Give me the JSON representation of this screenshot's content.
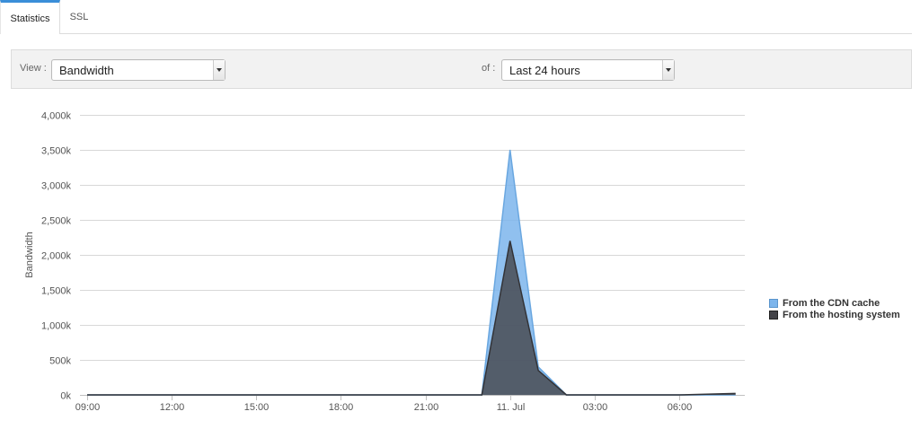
{
  "tabs": [
    {
      "label": "Statistics",
      "active": true
    },
    {
      "label": "SSL",
      "active": false
    }
  ],
  "filters": {
    "view_label": "View :",
    "view_value": "Bandwidth",
    "of_label": "of :",
    "of_value": "Last 24 hours"
  },
  "chart_data": {
    "type": "area",
    "ylabel": "Bandwidth",
    "xlabel": "",
    "ylim": [
      0,
      4000000
    ],
    "y_ticks": [
      {
        "value": 0,
        "label": "0k"
      },
      {
        "value": 500000,
        "label": "500k"
      },
      {
        "value": 1000000,
        "label": "1,000k"
      },
      {
        "value": 1500000,
        "label": "1,500k"
      },
      {
        "value": 2000000,
        "label": "2,000k"
      },
      {
        "value": 2500000,
        "label": "2,500k"
      },
      {
        "value": 3000000,
        "label": "3,000k"
      },
      {
        "value": 3500000,
        "label": "3,500k"
      },
      {
        "value": 4000000,
        "label": "4,000k"
      }
    ],
    "x_unit": "hours since 09:00",
    "xlim": [
      0,
      23.2
    ],
    "x_ticks": [
      {
        "value": 0,
        "label": "09:00"
      },
      {
        "value": 3,
        "label": "12:00"
      },
      {
        "value": 6,
        "label": "15:00"
      },
      {
        "value": 9,
        "label": "18:00"
      },
      {
        "value": 12,
        "label": "21:00"
      },
      {
        "value": 15,
        "label": "11. Jul"
      },
      {
        "value": 18,
        "label": "03:00"
      },
      {
        "value": 21,
        "label": "06:00"
      }
    ],
    "series": [
      {
        "name": "From the CDN cache",
        "color": "#7cb5ec",
        "x": [
          0,
          3,
          6,
          9,
          12,
          14,
          15,
          16,
          17,
          18,
          21,
          23
        ],
        "values": [
          0,
          0,
          0,
          0,
          0,
          0,
          3500000,
          400000,
          0,
          0,
          0,
          0
        ]
      },
      {
        "name": "From the hosting system",
        "color": "#434348",
        "x": [
          0,
          3,
          6,
          9,
          12,
          14,
          15,
          16,
          17,
          18,
          21,
          23
        ],
        "values": [
          0,
          0,
          0,
          0,
          0,
          0,
          2200000,
          350000,
          0,
          0,
          0,
          20000
        ]
      }
    ],
    "legend_position": "right",
    "grid": true
  }
}
